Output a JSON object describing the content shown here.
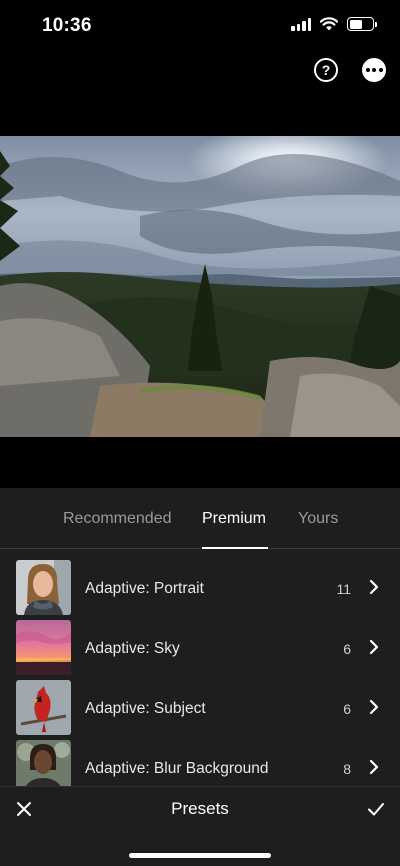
{
  "status_bar": {
    "time": "10:36",
    "battery_level": 0.55
  },
  "header": {
    "help_label": "?"
  },
  "tabs": [
    {
      "label": "Recommended",
      "active": false
    },
    {
      "label": "Premium",
      "active": true
    },
    {
      "label": "Yours",
      "active": false
    }
  ],
  "presets": [
    {
      "name": "Adaptive: Portrait",
      "count": "11",
      "icon": "portrait-thumbnail"
    },
    {
      "name": "Adaptive: Sky",
      "count": "6",
      "icon": "sky-thumbnail"
    },
    {
      "name": "Adaptive: Subject",
      "count": "6",
      "icon": "subject-thumbnail"
    },
    {
      "name": "Adaptive: Blur Background",
      "count": "8",
      "icon": "blur-background-thumbnail"
    }
  ],
  "bottom_bar": {
    "title": "Presets"
  },
  "colors": {
    "panel_background": "#1e1e1e",
    "inactive_tab": "#9a9a9a",
    "active_tab": "#ffffff"
  }
}
